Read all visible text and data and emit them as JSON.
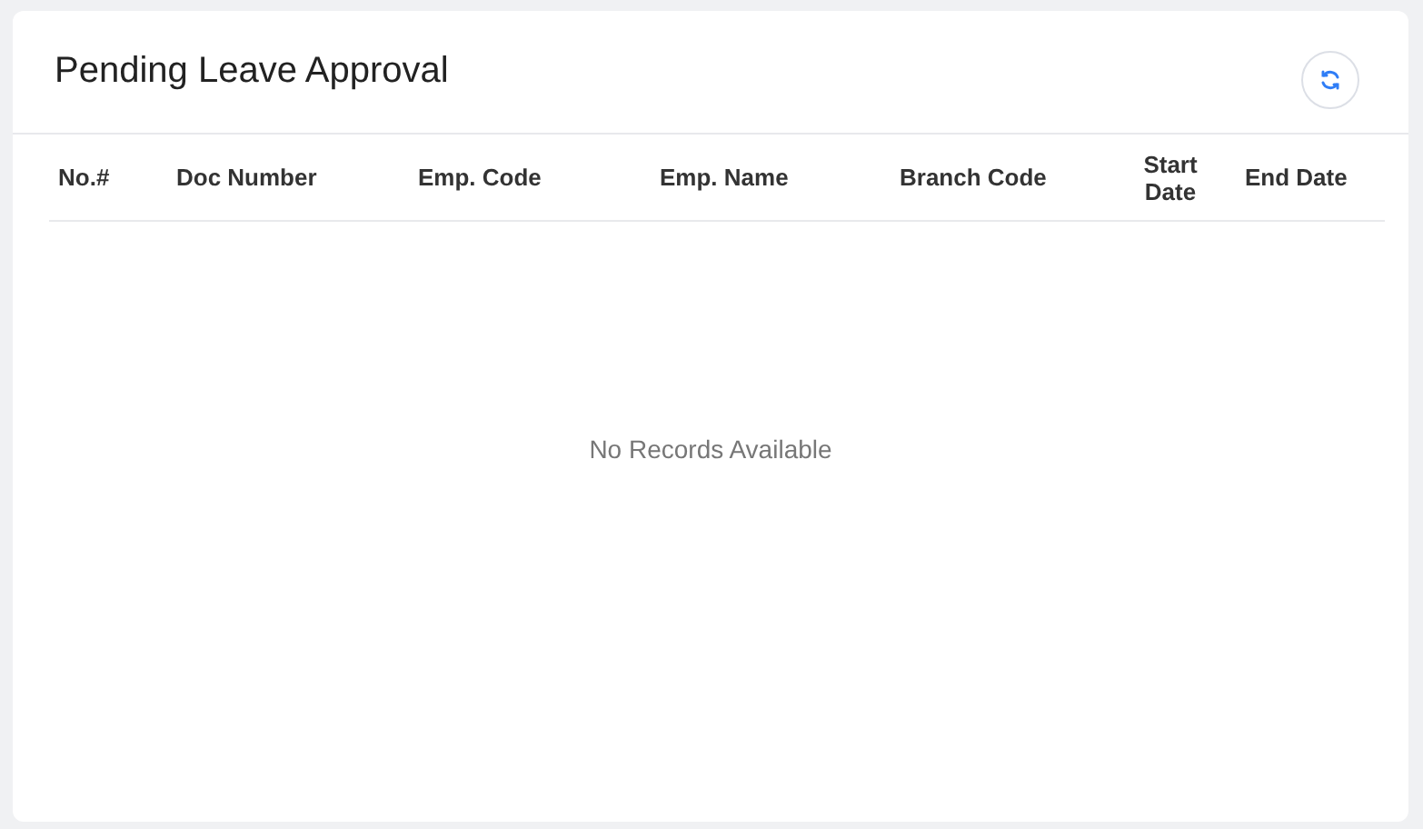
{
  "card": {
    "title": "Pending Leave Approval"
  },
  "table": {
    "columns": [
      "No.#",
      "Doc Number",
      "Emp. Code",
      "Emp. Name",
      "Branch Code",
      "Start Date",
      "End Date"
    ],
    "empty_message": "No Records Available"
  }
}
